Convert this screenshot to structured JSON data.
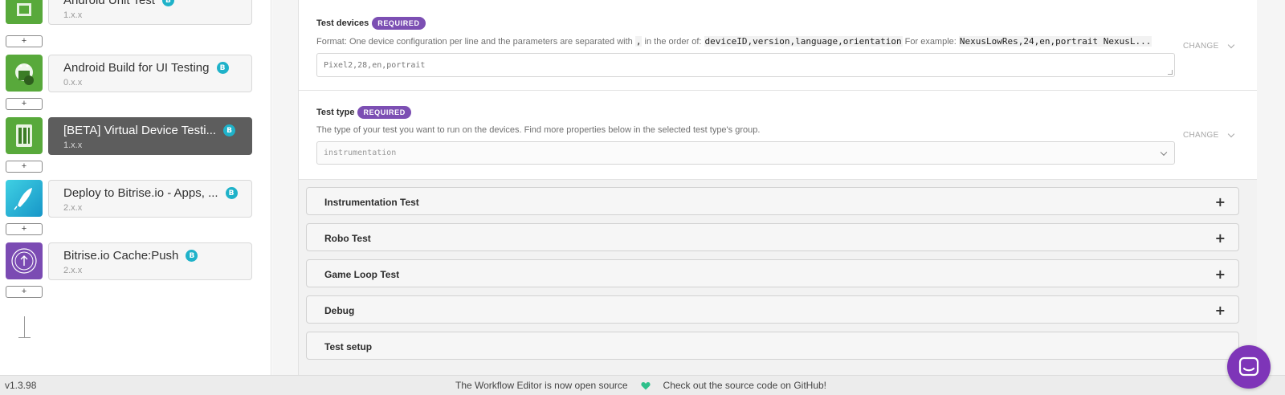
{
  "workflow": {
    "steps": [
      {
        "title": "Android Unit Test",
        "version": "1.x.x",
        "badge": "B",
        "icon": "android-test-icon",
        "selected": false
      },
      {
        "title": "Android Build for UI Testing",
        "version": "0.x.x",
        "badge": "B",
        "icon": "android-build-icon",
        "selected": false
      },
      {
        "title": "[BETA] Virtual Device Testi...",
        "version": "1.x.x",
        "badge": "B",
        "icon": "virtual-device-icon",
        "selected": true
      },
      {
        "title": "Deploy to Bitrise.io - Apps, ...",
        "version": "2.x.x",
        "badge": "B",
        "icon": "rocket-icon",
        "selected": false
      },
      {
        "title": "Bitrise.io Cache:Push",
        "version": "2.x.x",
        "badge": "B",
        "icon": "cache-push-icon",
        "selected": false
      }
    ],
    "add_label": "+"
  },
  "inputs": {
    "test_devices": {
      "label": "Test devices",
      "required": "REQUIRED",
      "desc_1": "Format: One device configuration per line and the parameters are separated with",
      "desc_sep": ",",
      "desc_2": "in the order of:",
      "desc_code": "deviceID,version,language,orientation",
      "desc_3": "For example:",
      "desc_example": "NexusLowRes,24,en,portrait NexusL...",
      "value": "Pixel2,28,en,portrait",
      "change": "CHANGE"
    },
    "test_type": {
      "label": "Test type",
      "required": "REQUIRED",
      "desc": "The type of your test you want to run on the devices. Find more properties below in the selected test type's group.",
      "value": "instrumentation",
      "change": "CHANGE"
    }
  },
  "groups": [
    {
      "title": "Instrumentation Test",
      "toggle": "+"
    },
    {
      "title": "Robo Test",
      "toggle": "+"
    },
    {
      "title": "Game Loop Test",
      "toggle": "+"
    },
    {
      "title": "Debug",
      "toggle": "+"
    },
    {
      "title": "Test setup",
      "toggle": ""
    }
  ],
  "footer": {
    "version": "v1.3.98",
    "message_1": "The Workflow Editor is now open source",
    "message_2": "Check out the source code on GitHub!"
  },
  "colors": {
    "accent": "#7c4fb3",
    "bitrise_badge": "#1fb2c9",
    "selected_step": "#5d5d5d",
    "heart": "#2ec08b",
    "chat": "#7e35b8"
  }
}
